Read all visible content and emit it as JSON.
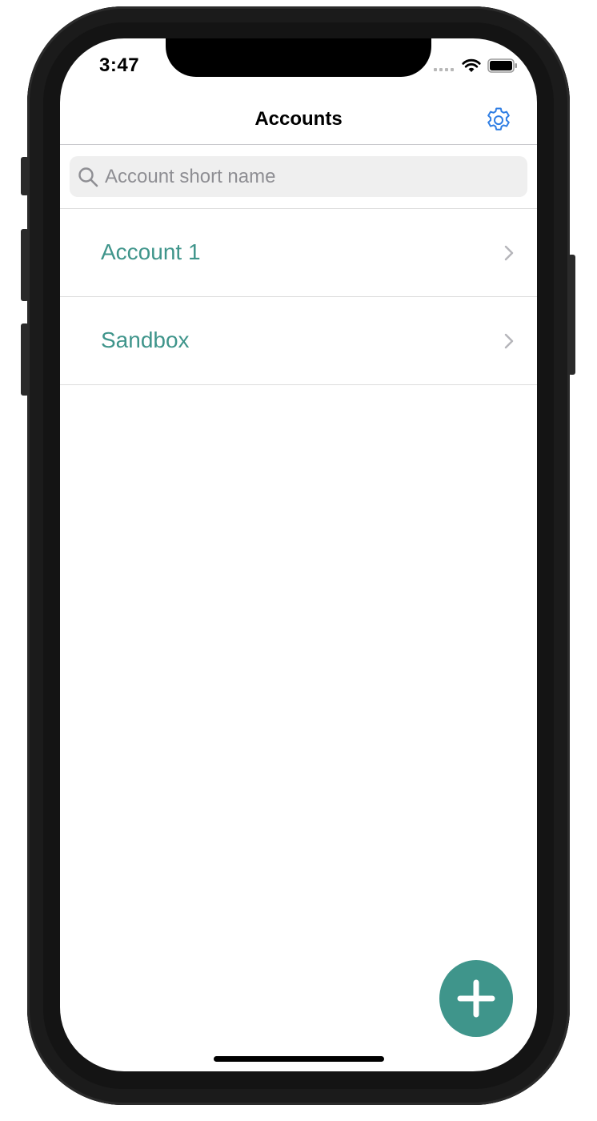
{
  "status_bar": {
    "time": "3:47",
    "icons": [
      "signal-dots-icon",
      "wifi-icon",
      "battery-icon"
    ]
  },
  "nav": {
    "title": "Accounts",
    "settings_icon": "gear-icon"
  },
  "search": {
    "placeholder": "Account short name",
    "value": "",
    "icon": "search-icon"
  },
  "accounts": {
    "items": [
      {
        "label": "Account 1"
      },
      {
        "label": "Sandbox"
      }
    ]
  },
  "fab": {
    "icon": "plus-icon"
  },
  "colors": {
    "accent": "#3f958b",
    "link_blue": "#2f7ee4",
    "separator": "#dcdcdc",
    "search_bg": "#efefef",
    "placeholder": "#8e8e93"
  }
}
